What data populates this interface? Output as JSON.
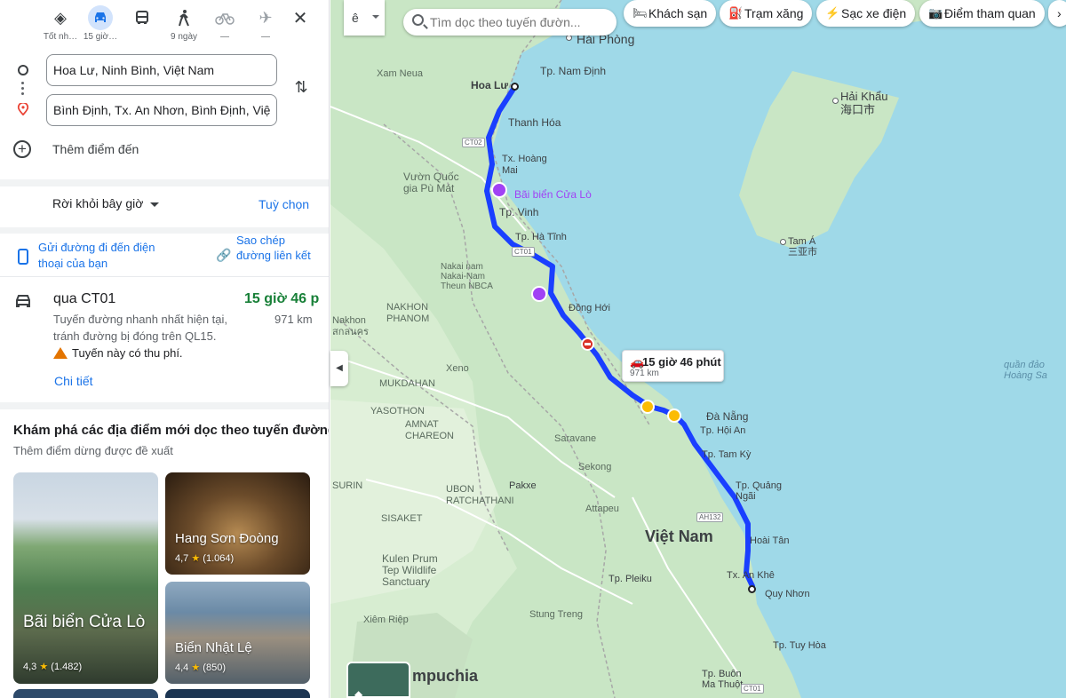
{
  "modes": [
    {
      "label": "Tốt nh…",
      "icon": "diamond-directions-icon"
    },
    {
      "label": "15 giờ…",
      "icon": "car-icon"
    },
    {
      "label": "",
      "icon": "bus-icon"
    },
    {
      "label": "9 ngày",
      "icon": "walk-icon"
    },
    {
      "label": "—",
      "icon": "bike-icon"
    },
    {
      "label": "—",
      "icon": "plane-icon"
    }
  ],
  "origin": "Hoa Lư, Ninh Bình, Việt Nam",
  "destination": "Bình Định, Tx. An Nhơn, Bình Định, Việt Nam",
  "add_stop": "Thêm điểm đến",
  "depart_label": "Rời khỏi bây giờ",
  "options_label": "Tuỳ chọn",
  "share": {
    "send_to_phone": "Gửi đường đi đến điện thoại của bạn",
    "copy_link": "Sao chép đường liên kết"
  },
  "route": {
    "via": "qua CT01",
    "duration": "15 giờ 46 p",
    "distance": "971 km",
    "description": "Tuyến đường nhanh nhất hiện tại, tránh đường bị đóng trên QL15.",
    "toll_warning": "Tuyến này có thu phí.",
    "details": "Chi tiết"
  },
  "explore": {
    "title": "Khám phá các địa điểm mới dọc theo tuyến đường",
    "subtitle": "Thêm điểm dừng được đề xuất",
    "cards": [
      {
        "name": "Bãi biển Cửa Lò",
        "rating": "4,3",
        "reviews": "(1.482)"
      },
      {
        "name": "Hang Sơn Đoòng",
        "rating": "4,7",
        "reviews": "(1.064)"
      },
      {
        "name": "Biển Nhật Lệ",
        "rating": "4,4",
        "reviews": "(850)"
      }
    ]
  },
  "map": {
    "search_placeholder": "Tìm dọc theo tuyến đườn...",
    "lang_button": "ê",
    "chips": [
      "Khách sạn",
      "Trạm xăng",
      "Sạc xe điện",
      "Điểm tham quan"
    ],
    "callout_duration": "15 giờ 46 phút",
    "callout_distance": "971 km",
    "route_color": "#1a53ff",
    "labels": {
      "haiphong": "Hải Phòng",
      "namdinh": "Tp. Nam Định",
      "hoalu": "Hoa Lư",
      "thanhhoa": "Thanh Hóa",
      "xamnua": "Xam Neua",
      "txhoangmai": "Tx. Hoàng\nMai",
      "vuonquoc": "Vườn Quốc\ngia Pù Mát",
      "cualo": "Bãi biển Cửa Lò",
      "vinh": "Tp. Vinh",
      "hatinh": "Tp. Hà Tĩnh",
      "dongho": "Đồng Hới",
      "nakai": "Nakai nam\nNakai-Nam\nTheun NBCA",
      "nakhon": "Nakhon\nPhanom",
      "xeno": "Xeno",
      "mukdahan": "MUKDAHAN",
      "yasothon": "YASOTHON",
      "amnat": "AMNAT\nCHAREON",
      "danang": "Đà Nẵng",
      "hoian": "Tp. Hội An",
      "tamky": "Tp. Tam Kỳ",
      "saravane": "Saravane",
      "sekong": "Sekong",
      "pakxe": "Pakxe",
      "attapeu": "Attapeu",
      "quangngai": "Tp. Quảng\nNgãi",
      "vietnam": "Việt Nam",
      "hoaitan": "Hoài Tân",
      "anke": "Tx. An Khê",
      "quynhon": "Quy Nhơn",
      "pleiku": "Tp. Pleiku",
      "tuyhoa": "Tp. Tuy Hòa",
      "buonmathuot": "Tp. Buôn\nMa Thuột",
      "kulen": "Kulen Prum\nTep Wildlife\nSanctuary",
      "stungtreng": "Stung Treng",
      "xiemriep": "Xiêm Riệp",
      "campuchia": "mpuchia",
      "haikhau": "Hải Khẩu\n海口市",
      "tama": "Tam Á\n三亚市",
      "quandao": "quần đảo\nHoàng Sa",
      "surin": "SURIN",
      "sisaket": "SISAKET",
      "ubon": "UBON\nRATCHATHANI",
      "nakhonp": "NAKHON\nPHANOM",
      "nakhon2": "Nakhon\nสกลนคร"
    }
  }
}
